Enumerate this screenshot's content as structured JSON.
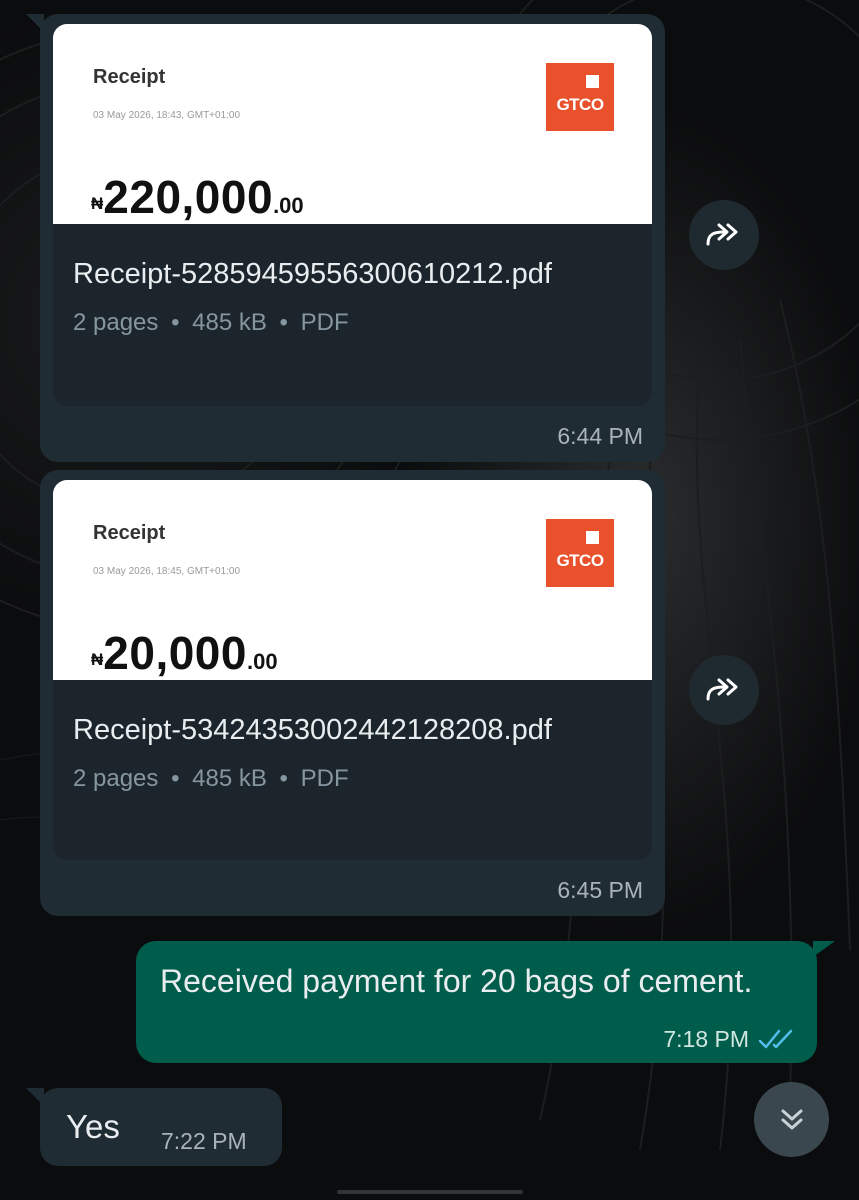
{
  "messages": [
    {
      "type": "document",
      "preview": {
        "title": "Receipt",
        "date": "03 May 2026, 18:43, GMT+01:00",
        "currency": "₦",
        "amount": "220,000",
        "decimals": ".00",
        "logo": "GTCO"
      },
      "filename": "Receipt-5285945955630061021​2.pdf",
      "pages": "2 pages",
      "size": "485 kB",
      "filetype": "PDF",
      "time": "6:44 PM"
    },
    {
      "type": "document",
      "preview": {
        "title": "Receipt",
        "date": "03 May 2026, 18:45, GMT+01:00",
        "currency": "₦",
        "amount": "20,000",
        "decimals": ".00",
        "logo": "GTCO"
      },
      "filename": "Receipt-5342435300244212820​8.pdf",
      "pages": "2 pages",
      "size": "485 kB",
      "filetype": "PDF",
      "time": "6:45 PM"
    },
    {
      "type": "text",
      "direction": "outgoing",
      "text": "Received payment for 20 bags of cement.",
      "time": "7:18 PM",
      "status": "read"
    },
    {
      "type": "text",
      "direction": "incoming",
      "text": "Yes",
      "time": "7:22 PM"
    }
  ],
  "separator": "•",
  "icons": {
    "forward": "forward-icon",
    "read_receipt": "double-check-icon",
    "scroll_down": "chevron-double-down-icon"
  },
  "colors": {
    "incoming_bubble": "#202c33",
    "outgoing_bubble": "#005c4b",
    "doc_card": "#1b252b",
    "gtco_brand": "#e8512b",
    "read_tick": "#53bdeb",
    "meta_text": "#8696a0"
  }
}
